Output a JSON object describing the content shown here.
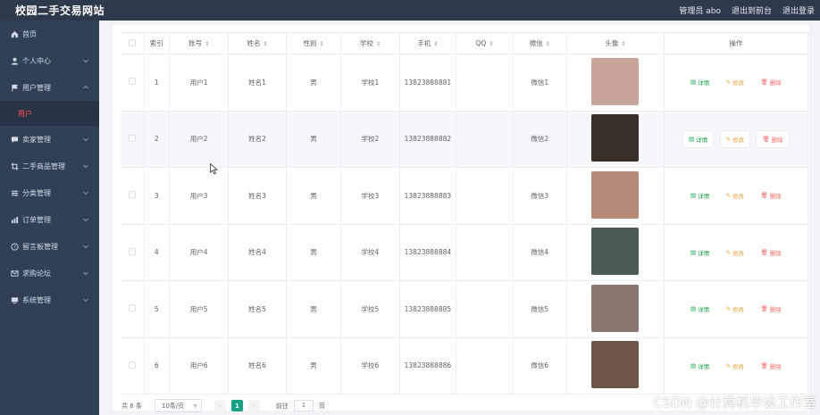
{
  "header": {
    "brand": "校园二手交易网站",
    "admin_label": "管理员 abo",
    "backend_link": "退出到前台",
    "logout_link": "退出登录"
  },
  "sidebar": {
    "items": [
      {
        "label": "首页",
        "icon": "home-icon",
        "has_arrow": false
      },
      {
        "label": "个人中心",
        "icon": "user-icon",
        "has_arrow": true
      },
      {
        "label": "用户管理",
        "icon": "flag-icon",
        "has_arrow": true,
        "expanded": true
      },
      {
        "label": "卖家管理",
        "icon": "chat-icon",
        "has_arrow": true
      },
      {
        "label": "二手商品管理",
        "icon": "crop-icon",
        "has_arrow": true
      },
      {
        "label": "分类管理",
        "icon": "sliders-icon",
        "has_arrow": true
      },
      {
        "label": "订单管理",
        "icon": "chart-icon",
        "has_arrow": true
      },
      {
        "label": "留言板管理",
        "icon": "question-icon",
        "has_arrow": true
      },
      {
        "label": "求购论坛",
        "icon": "mail-icon",
        "has_arrow": true
      },
      {
        "label": "系统管理",
        "icon": "monitor-icon",
        "has_arrow": true
      }
    ],
    "submenu": {
      "label": "用户"
    }
  },
  "table": {
    "columns": [
      "索引",
      "账号",
      "姓名",
      "性别",
      "学校",
      "手机",
      "QQ",
      "微信",
      "头像",
      "操作"
    ],
    "rows": [
      {
        "index": "1",
        "account": "用户1",
        "name": "姓名1",
        "gender": "男",
        "school": "学校1",
        "phone": "13823888881",
        "qq": "",
        "wechat": "微信1"
      },
      {
        "index": "2",
        "account": "用户2",
        "name": "姓名2",
        "gender": "男",
        "school": "学校2",
        "phone": "13823888882",
        "qq": "",
        "wechat": "微信2"
      },
      {
        "index": "3",
        "account": "用户3",
        "name": "姓名3",
        "gender": "男",
        "school": "学校3",
        "phone": "13823888883",
        "qq": "",
        "wechat": "微信3"
      },
      {
        "index": "4",
        "account": "用户4",
        "name": "姓名4",
        "gender": "男",
        "school": "学校4",
        "phone": "13823888884",
        "qq": "",
        "wechat": "微信4"
      },
      {
        "index": "5",
        "account": "用户5",
        "name": "姓名5",
        "gender": "男",
        "school": "学校5",
        "phone": "13823888885",
        "qq": "",
        "wechat": "微信5"
      },
      {
        "index": "6",
        "account": "用户6",
        "name": "姓名6",
        "gender": "男",
        "school": "学校6",
        "phone": "13823888886",
        "qq": "",
        "wechat": "微信6"
      }
    ],
    "actions": {
      "detail": "详情",
      "edit": "修改",
      "delete": "删除"
    }
  },
  "pagination": {
    "total_label": "共 6 条",
    "page_size": "10条/页",
    "current_page": "1",
    "goto_label": "前往",
    "goto_value": "1",
    "page_unit": "页"
  },
  "watermark": "CSDN @计算机毕设工作室",
  "colors": {
    "header_bg": "#2d3a4b",
    "sidebar_bg": "#304156",
    "active_submenu": "#ff4a55",
    "page_active": "#16a085",
    "detail": "#16a34a",
    "edit": "#e6a23c",
    "delete": "#f56c6c"
  }
}
